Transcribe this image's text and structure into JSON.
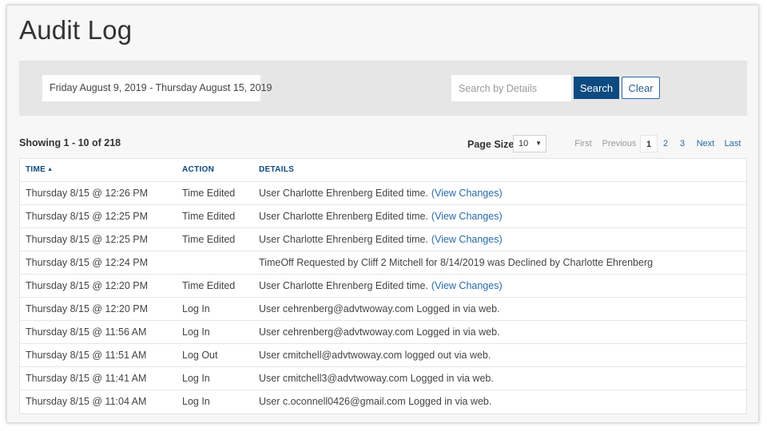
{
  "page": {
    "title": "Audit Log"
  },
  "filters": {
    "date_range": "Friday August 9, 2019 - Thursday August 15, 2019",
    "search_placeholder": "Search by Details",
    "search_value": "",
    "search_label": "Search",
    "clear_label": "Clear"
  },
  "summary": {
    "showing": "Showing 1 - 10 of 218"
  },
  "page_size": {
    "label": "Page Size:",
    "value": "10"
  },
  "pagination": {
    "first": "First",
    "previous": "Previous",
    "pages": [
      "1",
      "2",
      "3"
    ],
    "current": "1",
    "next": "Next",
    "last": "Last"
  },
  "table": {
    "headers": {
      "time": "TIME",
      "action": "ACTION",
      "details": "DETAILS"
    },
    "view_changes_label": "(View Changes)",
    "rows": [
      {
        "time": "Thursday 8/15 @ 12:26 PM",
        "action": "Time Edited",
        "details": "User Charlotte Ehrenberg Edited time.",
        "link": true
      },
      {
        "time": "Thursday 8/15 @ 12:25 PM",
        "action": "Time Edited",
        "details": "User Charlotte Ehrenberg Edited time.",
        "link": true
      },
      {
        "time": "Thursday 8/15 @ 12:25 PM",
        "action": "Time Edited",
        "details": "User Charlotte Ehrenberg Edited time.",
        "link": true
      },
      {
        "time": "Thursday 8/15 @ 12:24 PM",
        "action": "",
        "details": "TimeOff Requested by Cliff 2 Mitchell for 8/14/2019 was Declined by Charlotte Ehrenberg",
        "link": false
      },
      {
        "time": "Thursday 8/15 @ 12:20 PM",
        "action": "Time Edited",
        "details": "User Charlotte Ehrenberg Edited time.",
        "link": true
      },
      {
        "time": "Thursday 8/15 @ 12:20 PM",
        "action": "Log In",
        "details": "User cehrenberg@advtwoway.com Logged in via web.",
        "link": false
      },
      {
        "time": "Thursday 8/15 @ 11:56 AM",
        "action": "Log In",
        "details": "User cehrenberg@advtwoway.com Logged in via web.",
        "link": false
      },
      {
        "time": "Thursday 8/15 @ 11:51 AM",
        "action": "Log Out",
        "details": "User cmitchell@advtwoway.com logged out via web.",
        "link": false
      },
      {
        "time": "Thursday 8/15 @ 11:41 AM",
        "action": "Log In",
        "details": "User cmitchell3@advtwoway.com Logged in via web.",
        "link": false
      },
      {
        "time": "Thursday 8/15 @ 11:04 AM",
        "action": "Log In",
        "details": "User c.oconnell0426@gmail.com Logged in via web.",
        "link": false
      }
    ]
  },
  "icons": {
    "sort": "sort-ascending-icon",
    "select_caret": "caret-down-icon"
  },
  "colors": {
    "primary": "#0c4a80",
    "link": "#2a6aa8",
    "filter_bar": "#e6e6e6"
  }
}
